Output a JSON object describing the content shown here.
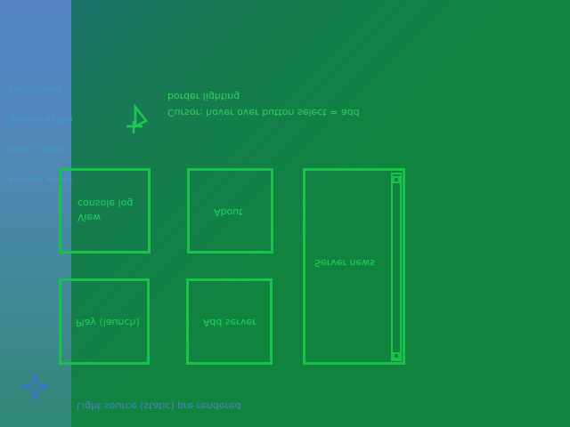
{
  "sidebar": {
    "note_lines": [
      "background",
      "graphic as the",
      "have a glass",
      "buttons would"
    ]
  },
  "notes": {
    "border_lighting": "border lighting",
    "cursor_hint": "Cursor: hover over button select = add"
  },
  "tiles": {
    "console_line1": "console log",
    "console_line2": "View",
    "about": "About",
    "server_news": "Server news",
    "play": "Play (launch)",
    "add_server": "Add server"
  },
  "footer": {
    "light_source": "Light source (static) pre rendered"
  },
  "icons": {
    "cursor": "cursor-arrow-icon",
    "light": "light-source-icon",
    "scroll_up": "scroll-up-icon",
    "scroll_down": "scroll-down-icon"
  },
  "colors": {
    "background": "#10843f",
    "border": "#19c24a",
    "sidebar_top": "#5383c4",
    "sidebar_bottom": "#2f8774"
  }
}
